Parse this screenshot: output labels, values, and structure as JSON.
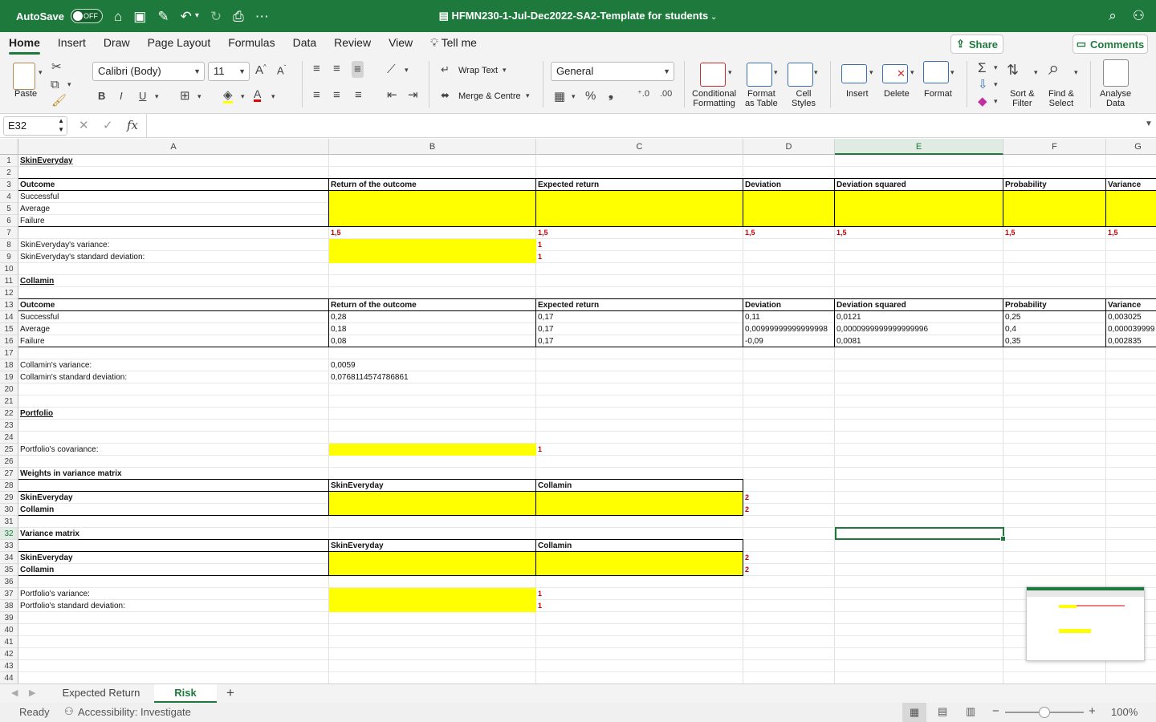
{
  "titlebar": {
    "autosave_label": "AutoSave",
    "autosave_state": "OFF",
    "doc_title": "HFMN230-1-Jul-Dec2022-SA2-Template for students"
  },
  "tabs": [
    "Home",
    "Insert",
    "Draw",
    "Page Layout",
    "Formulas",
    "Data",
    "Review",
    "View",
    "Tell me"
  ],
  "share_label": "Share",
  "comments_label": "Comments",
  "ribbon": {
    "paste": "Paste",
    "font_name": "Calibri (Body)",
    "font_size": "11",
    "wrap_text": "Wrap Text",
    "merge_centre": "Merge & Centre",
    "number_format": "General",
    "conditional_formatting": [
      "Conditional",
      "Formatting"
    ],
    "format_as_table": [
      "Format",
      "as Table"
    ],
    "cell_styles": [
      "Cell",
      "Styles"
    ],
    "insert": "Insert",
    "delete": "Delete",
    "format": "Format",
    "sort_filter": [
      "Sort &",
      "Filter"
    ],
    "find_select": [
      "Find &",
      "Select"
    ],
    "analyse_data": [
      "Analyse",
      "Data"
    ]
  },
  "formula_bar": {
    "name_box": "E32",
    "fx": "fx",
    "content": ""
  },
  "columns": [
    "A",
    "B",
    "C",
    "D",
    "E",
    "F",
    "G"
  ],
  "rows": [
    "1",
    "2",
    "3",
    "4",
    "5",
    "6",
    "7",
    "8",
    "9",
    "10",
    "11",
    "12",
    "13",
    "14",
    "15",
    "16",
    "17",
    "18",
    "19",
    "20",
    "21",
    "22",
    "23",
    "24",
    "25",
    "26",
    "27",
    "28",
    "29",
    "30",
    "31",
    "32",
    "33",
    "34",
    "35",
    "36",
    "37",
    "38",
    "39",
    "40",
    "41",
    "42",
    "43",
    "44"
  ],
  "cells": {
    "r1a": "SkinEveryday",
    "r3a": "Outcome",
    "r3b": "Return of the outcome",
    "r3c": "Expected return",
    "r3d": "Deviation",
    "r3e": "Deviation squared",
    "r3f": "Probability",
    "r3g": "Variance",
    "r4a": "Successful",
    "r5a": "Average",
    "r6a": "Failure",
    "r7b": "1,5",
    "r7c": "1,5",
    "r7d": "1,5",
    "r7e": "1,5",
    "r7f": "1,5",
    "r7g": "1,5",
    "r8a": "SkinEveryday's variance:",
    "r8c": "1",
    "r9a": "SkinEveryday's standard deviation:",
    "r9c": "1",
    "r11a": "Collamin",
    "r13a": "Outcome",
    "r13b": "Return of the outcome",
    "r13c": "Expected return",
    "r13d": "Deviation",
    "r13e": "Deviation squared",
    "r13f": "Probability",
    "r13g": "Variance",
    "r14a": "Successful",
    "r14b": "0,28",
    "r14c": "0,17",
    "r14d": "0,11",
    "r14e": "0,0121",
    "r14f": "0,25",
    "r14g": "0,003025",
    "r15a": "Average",
    "r15b": "0,18",
    "r15c": "0,17",
    "r15d": "0,00999999999999998",
    "r15e": "0,0000999999999999996",
    "r15f": "0,4",
    "r15g": "0,000039999",
    "r16a": "Failure",
    "r16b": "0,08",
    "r16c": "0,17",
    "r16d": "-0,09",
    "r16e": "0,0081",
    "r16f": "0,35",
    "r16g": "0,002835",
    "r18a": "Collamin's variance:",
    "r18b": "0,0059",
    "r19a": "Collamin's standard deviation:",
    "r19b": "0,0768114574786861",
    "r22a": "Portfolio",
    "r25a": "Portfolio's covariance:",
    "r25c": "1",
    "r27a": "Weights in variance matrix",
    "r28b": "SkinEveryday",
    "r28c": "Collamin",
    "r29a": "SkinEveryday",
    "r29d": "2",
    "r30a": "Collamin",
    "r30d": "2",
    "r32a": "Variance matrix",
    "r33b": "SkinEveryday",
    "r33c": "Collamin",
    "r34a": "SkinEveryday",
    "r34d": "2",
    "r35a": "Collamin",
    "r35d": "2",
    "r37a": "Portfolio's variance:",
    "r37c": "1",
    "r38a": "Portfolio's standard deviation:",
    "r38c": "1"
  },
  "sheets": [
    "Expected Return",
    "Risk"
  ],
  "active_sheet": "Risk",
  "status": {
    "ready": "Ready",
    "accessibility": "Accessibility: Investigate",
    "zoom": "100%"
  },
  "colors": {
    "accent": "#1e7a3c",
    "highlight": "#ffff00",
    "error_red": "#c00000"
  }
}
